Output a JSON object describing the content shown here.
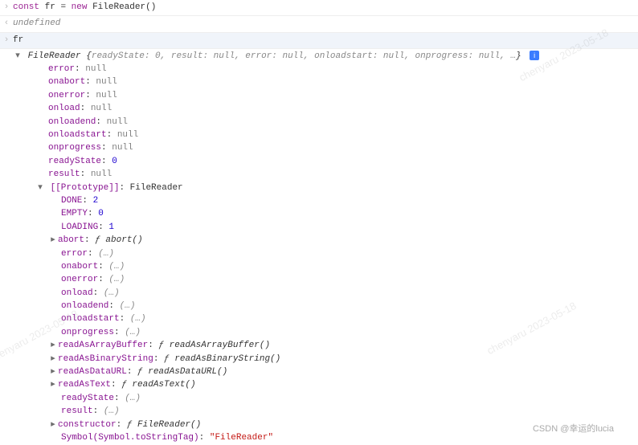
{
  "input1": {
    "const": "const",
    "var": "fr",
    "eq": "=",
    "new": "new",
    "cls": "FileReader",
    "parens": "()"
  },
  "result1": "undefined",
  "input2": "fr",
  "summary": {
    "name": "FileReader",
    "brace_open": "{",
    "pairs": "readyState: 0, result: null, error: null, onloadstart: null, onprogress: null, …",
    "brace_close": "}",
    "info": "i"
  },
  "props": [
    {
      "k": "error",
      "v": "null",
      "t": "null"
    },
    {
      "k": "onabort",
      "v": "null",
      "t": "null"
    },
    {
      "k": "onerror",
      "v": "null",
      "t": "null"
    },
    {
      "k": "onload",
      "v": "null",
      "t": "null"
    },
    {
      "k": "onloadend",
      "v": "null",
      "t": "null"
    },
    {
      "k": "onloadstart",
      "v": "null",
      "t": "null"
    },
    {
      "k": "onprogress",
      "v": "null",
      "t": "null"
    },
    {
      "k": "readyState",
      "v": "0",
      "t": "num"
    },
    {
      "k": "result",
      "v": "null",
      "t": "null"
    }
  ],
  "proto_label": "[[Prototype]]",
  "proto_value": "FileReader",
  "proto_props": [
    {
      "arrow": "",
      "k": "DONE",
      "v": "2",
      "t": "num"
    },
    {
      "arrow": "",
      "k": "EMPTY",
      "v": "0",
      "t": "num"
    },
    {
      "arrow": "",
      "k": "LOADING",
      "v": "1",
      "t": "num"
    },
    {
      "arrow": "right",
      "k": "abort",
      "pre": "ƒ ",
      "v": "abort()",
      "t": "f"
    },
    {
      "arrow": "",
      "k": "error",
      "v": "(…)",
      "t": "paren"
    },
    {
      "arrow": "",
      "k": "onabort",
      "v": "(…)",
      "t": "paren"
    },
    {
      "arrow": "",
      "k": "onerror",
      "v": "(…)",
      "t": "paren"
    },
    {
      "arrow": "",
      "k": "onload",
      "v": "(…)",
      "t": "paren"
    },
    {
      "arrow": "",
      "k": "onloadend",
      "v": "(…)",
      "t": "paren"
    },
    {
      "arrow": "",
      "k": "onloadstart",
      "v": "(…)",
      "t": "paren"
    },
    {
      "arrow": "",
      "k": "onprogress",
      "v": "(…)",
      "t": "paren"
    },
    {
      "arrow": "right",
      "k": "readAsArrayBuffer",
      "pre": "ƒ ",
      "v": "readAsArrayBuffer()",
      "t": "f"
    },
    {
      "arrow": "right",
      "k": "readAsBinaryString",
      "pre": "ƒ ",
      "v": "readAsBinaryString()",
      "t": "f"
    },
    {
      "arrow": "right",
      "k": "readAsDataURL",
      "pre": "ƒ ",
      "v": "readAsDataURL()",
      "t": "f"
    },
    {
      "arrow": "right",
      "k": "readAsText",
      "pre": "ƒ ",
      "v": "readAsText()",
      "t": "f"
    },
    {
      "arrow": "",
      "k": "readyState",
      "v": "(…)",
      "t": "paren"
    },
    {
      "arrow": "",
      "k": "result",
      "v": "(…)",
      "t": "paren"
    },
    {
      "arrow": "right",
      "k": "constructor",
      "pre": "ƒ ",
      "v": "FileReader()",
      "t": "f"
    },
    {
      "arrow": "",
      "k": "Symbol(Symbol.toStringTag)",
      "v": "\"FileReader\"",
      "t": "str"
    }
  ],
  "watermark": "chenyaru 2023-05-18",
  "footer": "CSDN @幸运的lucia"
}
